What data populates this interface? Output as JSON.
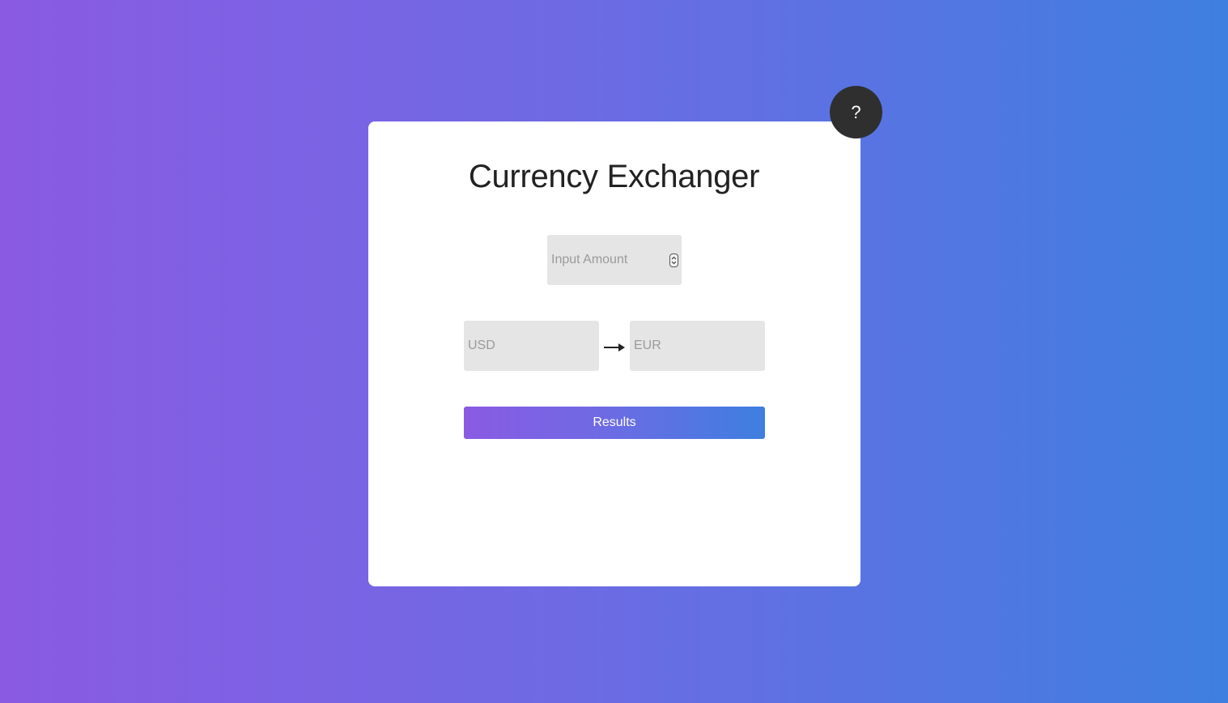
{
  "app": {
    "title": "Currency Exchanger",
    "help_label": "?"
  },
  "form": {
    "amount_placeholder": "Input Amount",
    "from_currency_placeholder": "USD",
    "to_currency_placeholder": "EUR",
    "submit_label": "Results"
  },
  "icons": {
    "help": "question-mark-icon",
    "direction": "right-arrow-icon",
    "stepper": "up-down-stepper-icon"
  },
  "colors": {
    "gradient_start": "#8a5ae3",
    "gradient_end": "#3e7fe0",
    "card_background": "#ffffff",
    "field_background": "#e5e5e5",
    "help_button": "#2f2f2f",
    "title_text": "#222222",
    "placeholder_text": "#9a9a9a"
  }
}
